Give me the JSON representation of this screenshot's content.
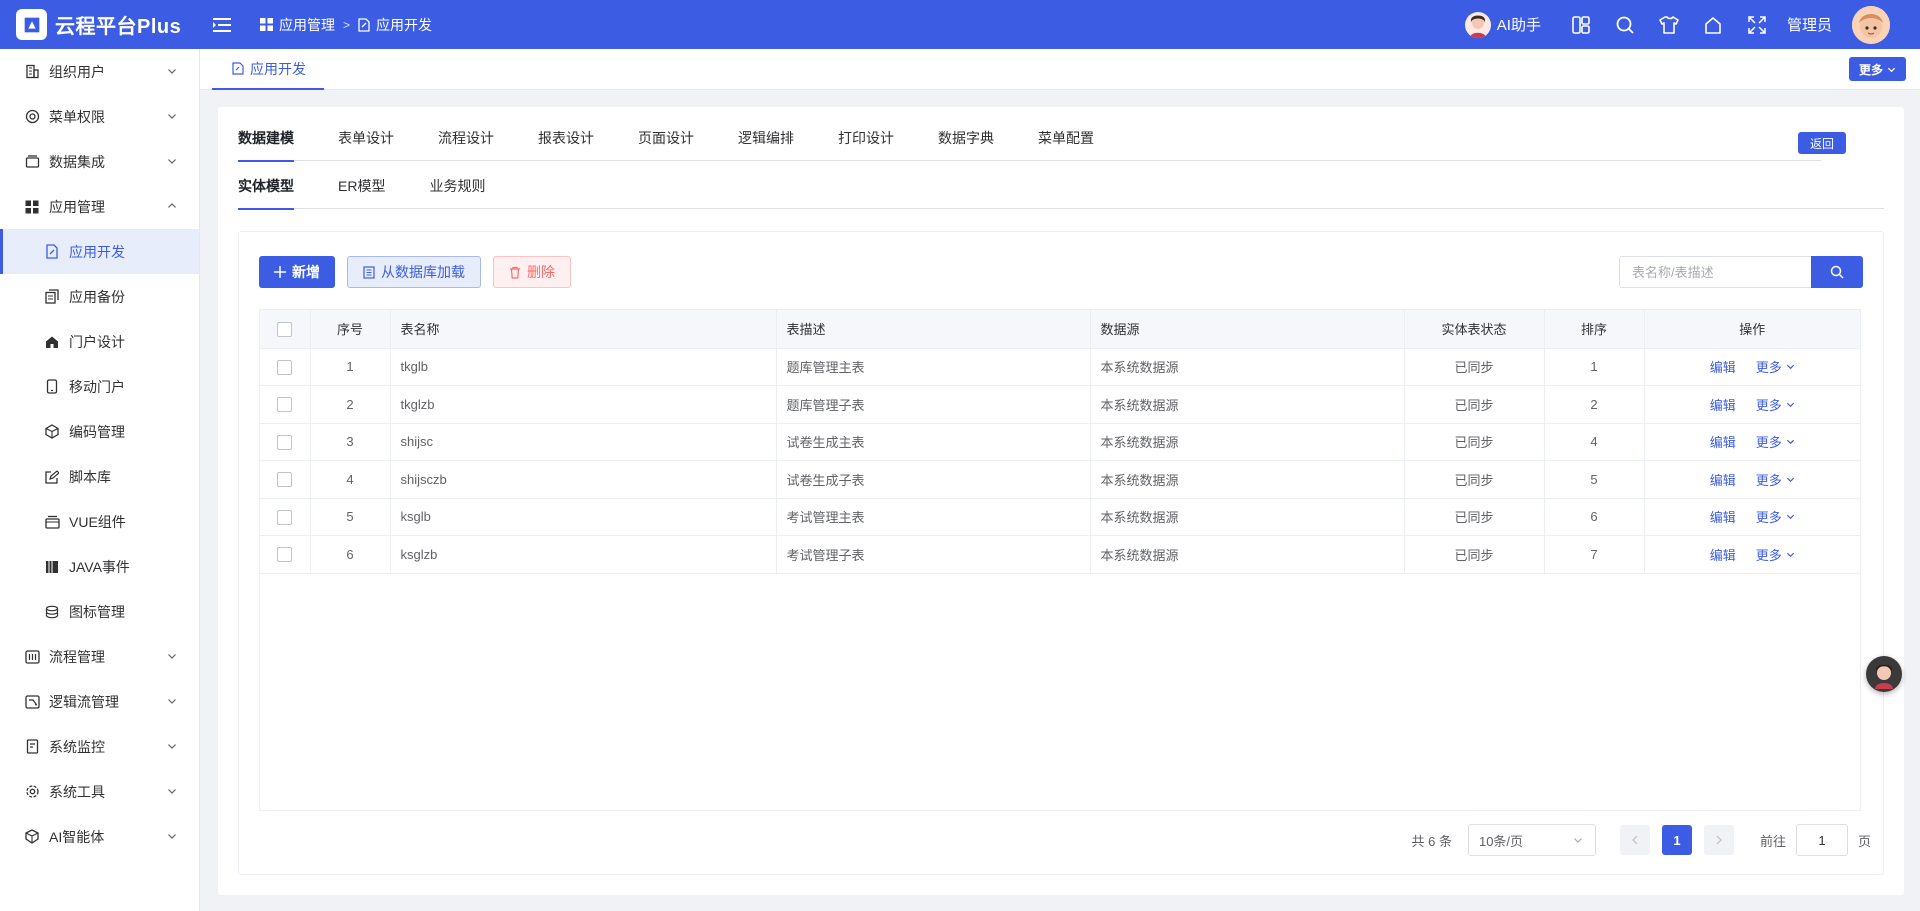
{
  "header": {
    "app_title": "云程平台Plus",
    "breadcrumb": [
      "应用管理",
      "应用开发"
    ],
    "ai_label": "AI助手",
    "admin_label": "管理员",
    "accent": "#3c5de3"
  },
  "sidebar": {
    "items": [
      {
        "label": "组织用户",
        "icon": "building-icon"
      },
      {
        "label": "菜单权限",
        "icon": "menu-shield-icon"
      },
      {
        "label": "数据集成",
        "icon": "database-box-icon"
      },
      {
        "label": "应用管理",
        "icon": "grid-icon"
      },
      {
        "label": "应用开发",
        "icon": "doc-edit-icon"
      },
      {
        "label": "应用备份",
        "icon": "copy-icon"
      },
      {
        "label": "门户设计",
        "icon": "home-icon"
      },
      {
        "label": "移动门户",
        "icon": "mobile-icon"
      },
      {
        "label": "编码管理",
        "icon": "cube-icon"
      },
      {
        "label": "脚本库",
        "icon": "edit-icon"
      },
      {
        "label": "VUE组件",
        "icon": "box-icon"
      },
      {
        "label": "JAVA事件",
        "icon": "book-icon"
      },
      {
        "label": "图标管理",
        "icon": "stack-icon"
      },
      {
        "label": "流程管理",
        "icon": "flow-icon"
      },
      {
        "label": "逻辑流管理",
        "icon": "logic-icon"
      },
      {
        "label": "系统监控",
        "icon": "monitor-icon"
      },
      {
        "label": "系统工具",
        "icon": "gear-icon"
      },
      {
        "label": "AI智能体",
        "icon": "robot-icon"
      }
    ]
  },
  "tabsbar": {
    "active_tab": "应用开发",
    "more_label": "更多"
  },
  "main_tabs": [
    "数据建模",
    "表单设计",
    "流程设计",
    "报表设计",
    "页面设计",
    "逻辑编排",
    "打印设计",
    "数据字典",
    "菜单配置"
  ],
  "back_label": "返回",
  "sub_tabs": [
    "实体模型",
    "ER模型",
    "业务规则"
  ],
  "toolbar": {
    "add_label": "新增",
    "load_label": "从数据库加载",
    "delete_label": "删除"
  },
  "search": {
    "placeholder": "表名称/表描述"
  },
  "table": {
    "columns": [
      "序号",
      "表名称",
      "表描述",
      "数据源",
      "实体表状态",
      "排序",
      "操作"
    ],
    "rows": [
      {
        "no": "1",
        "name": "tkglb",
        "desc": "题库管理主表",
        "source": "本系统数据源",
        "status": "已同步",
        "sort": "1"
      },
      {
        "no": "2",
        "name": "tkglzb",
        "desc": "题库管理子表",
        "source": "本系统数据源",
        "status": "已同步",
        "sort": "2"
      },
      {
        "no": "3",
        "name": "shijsc",
        "desc": "试卷生成主表",
        "source": "本系统数据源",
        "status": "已同步",
        "sort": "4"
      },
      {
        "no": "4",
        "name": "shijsczb",
        "desc": "试卷生成子表",
        "source": "本系统数据源",
        "status": "已同步",
        "sort": "5"
      },
      {
        "no": "5",
        "name": "ksglb",
        "desc": "考试管理主表",
        "source": "本系统数据源",
        "status": "已同步",
        "sort": "6"
      },
      {
        "no": "6",
        "name": "ksglzb",
        "desc": "考试管理子表",
        "source": "本系统数据源",
        "status": "已同步",
        "sort": "7"
      }
    ],
    "edit_label": "编辑",
    "more_label": "更多"
  },
  "pagination": {
    "total": "共 6 条",
    "page_size": "10条/页",
    "current_page": "1",
    "goto_label": "前往",
    "goto_value": "1",
    "page_unit": "页"
  }
}
